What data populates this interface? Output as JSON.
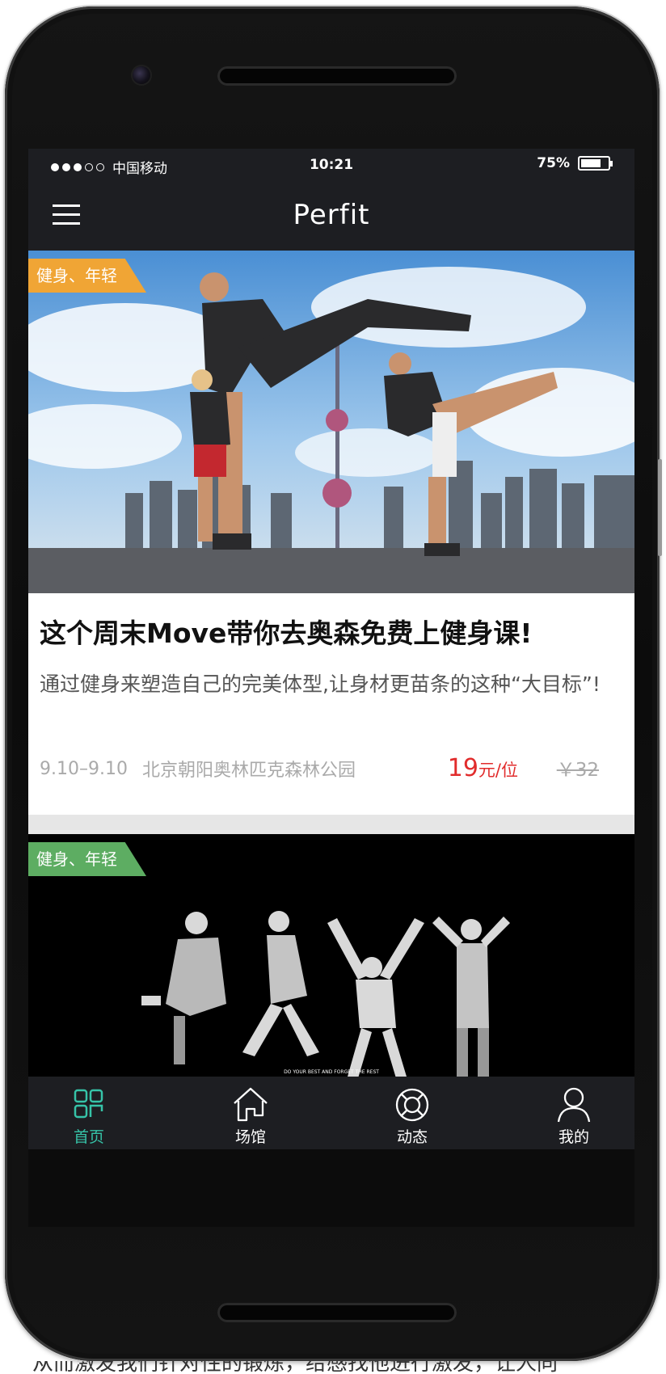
{
  "status_bar": {
    "carrier": "中国移动",
    "time": "10:21",
    "battery": "75%",
    "battery_level": 0.75
  },
  "nav": {
    "title": "Perfit",
    "menu_icon": "hamburger-menu-icon"
  },
  "cards": [
    {
      "tag": "健身、年轻",
      "tag_color": "#f0a535",
      "title": "这个周末Move带你去奥森免费上健身课!",
      "description": "通过健身来塑造自己的完美体型,让身材更苗条的这种“大目标”!",
      "date": "9.10–9.10",
      "location": "北京朝阳奥林匹克森林公园",
      "price": "19",
      "price_unit": "元/位",
      "original_price": "￥32"
    },
    {
      "tag": "健身、年轻",
      "tag_color": "#5dad62",
      "image_caption": "DO YOUR BEST AND FORGET THE REST"
    }
  ],
  "tabbar": {
    "accent": "#36c3a8",
    "items": [
      {
        "label": "首页",
        "icon": "home-grid-icon",
        "active": true
      },
      {
        "label": "场馆",
        "icon": "venue-house-icon",
        "active": false
      },
      {
        "label": "动态",
        "icon": "lifebuoy-icon",
        "active": false
      },
      {
        "label": "我的",
        "icon": "user-profile-icon",
        "active": false
      }
    ]
  },
  "caption": "从而激发我们针对性的锻炼，给感找他进行激发，让人同"
}
